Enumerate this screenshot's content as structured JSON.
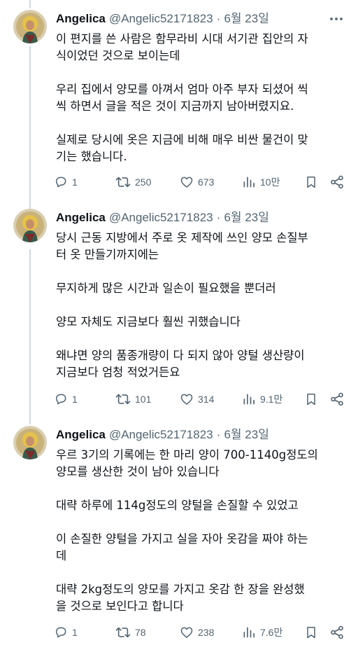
{
  "tweets": [
    {
      "author_name": "Angelica",
      "author_handle": "@Angelic52171823",
      "separator": "·",
      "date": "6월 23일",
      "paragraphs": [
        [
          "이 편지를 쓴 사람은 함무라비 시대 서기관 집안의 자",
          "식이었던 것으로 보이는데"
        ],
        [
          "우리 집에서 양모를 아껴서 엄마 아주 부자 되셨어 씩",
          "씩 하면서 글을 적은 것이 지금까지 남아버렸지요."
        ],
        [
          "실제로 당시에 옷은 지금에 비해 매우 비싼 물건이 맞",
          "기는 했습니다."
        ]
      ],
      "replies": "1",
      "retweets": "250",
      "likes": "673",
      "views": "10만"
    },
    {
      "author_name": "Angelica",
      "author_handle": "@Angelic52171823",
      "separator": "·",
      "date": "6월 23일",
      "paragraphs": [
        [
          "당시 근동 지방에서 주로 옷 제작에 쓰인 양모 손질부",
          "터 옷 만들기까지에는"
        ],
        [
          "무지하게 많은 시간과 일손이 필요했을 뿐더러"
        ],
        [
          "양모 자체도 지금보다 훨씬 귀했습니다"
        ],
        [
          "왜냐면 양의 품종개량이 다 되지 않아 양털 생산량이",
          "지금보다 엄청 적었거든요"
        ]
      ],
      "replies": "1",
      "retweets": "101",
      "likes": "314",
      "views": "9.1만"
    },
    {
      "author_name": "Angelica",
      "author_handle": "@Angelic52171823",
      "separator": "·",
      "date": "6월 23일",
      "paragraphs": [
        [
          "우르 3기의 기록에는 한 마리 양이 700-1140g정도의",
          "양모를 생산한 것이 남아 있습니다"
        ],
        [
          "대략 하루에 114g정도의 양털을 손질할 수 있었고"
        ],
        [
          "이 손질한 양털을 가지고 실을 자아 옷감을 짜야 하는",
          "데"
        ],
        [
          "대략 2kg정도의 양모를 가지고 옷감 한 장을 완성했",
          "을 것으로 보인다고 합니다"
        ]
      ],
      "replies": "1",
      "retweets": "78",
      "likes": "238",
      "views": "7.6만"
    }
  ],
  "icons": {
    "more": "more-dots-icon",
    "reply": "reply-icon",
    "retweet": "retweet-icon",
    "like": "heart-icon",
    "views": "views-icon",
    "bookmark": "bookmark-icon",
    "share": "share-icon"
  },
  "colors": {
    "text": "#0f1419",
    "muted": "#536471",
    "thread_line": "#cfd9de"
  }
}
